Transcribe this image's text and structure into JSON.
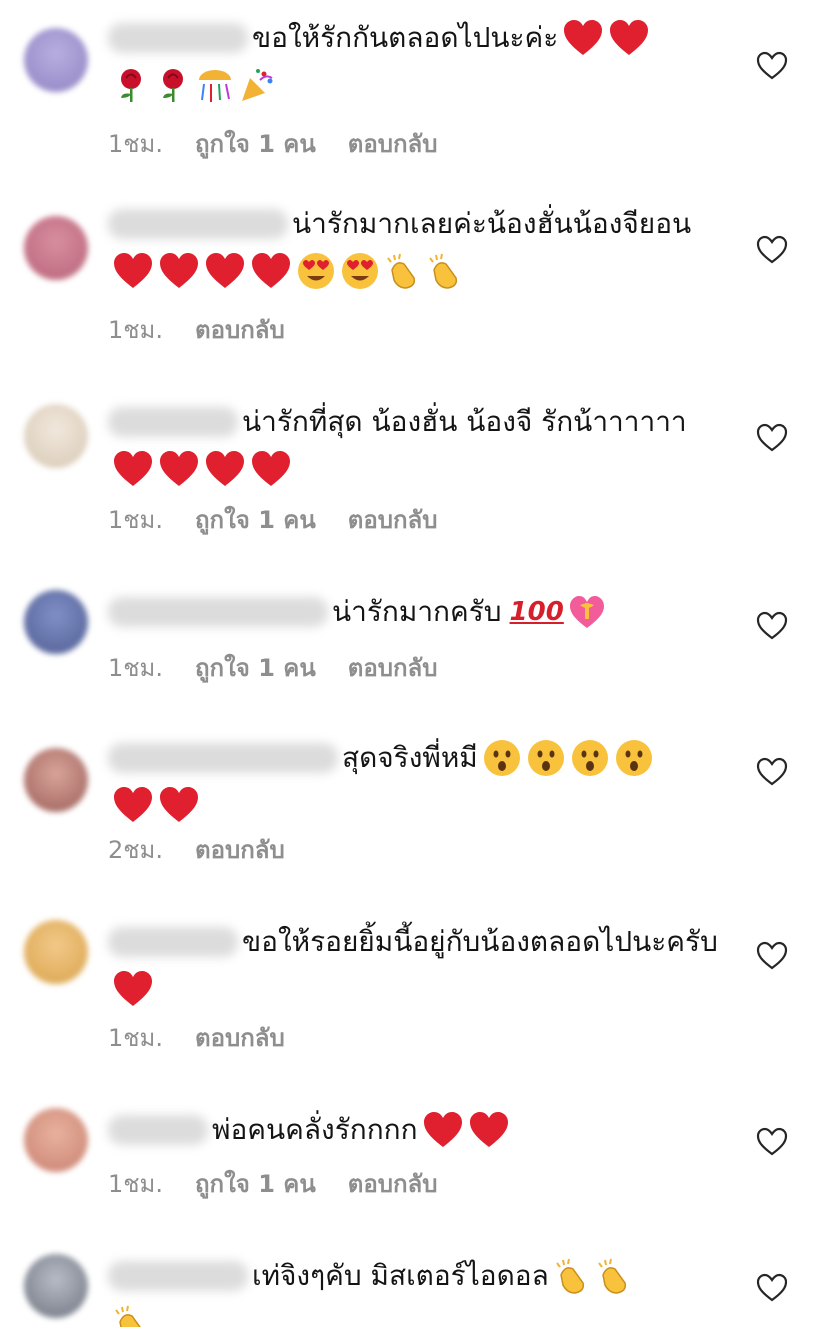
{
  "colors": {
    "text": "#141414",
    "meta": "#8e8e8e",
    "heart_red": "#e0202f",
    "icon_outline": "#262626"
  },
  "comments": [
    {
      "text": "ขอให้รักกันตลอดไปนะค่ะ",
      "emojis": [
        "red-heart",
        "red-heart",
        "rose",
        "rose",
        "confetti-ball",
        "party-popper"
      ],
      "time": "1ชม.",
      "likes": "ถูกใจ 1 คน",
      "reply": "ตอบกลับ"
    },
    {
      "text": "น่ารักมากเลยค่ะน้องฮั่นน้องจียอน",
      "emojis": [
        "red-heart",
        "red-heart",
        "red-heart",
        "red-heart",
        "heart-eyes",
        "heart-eyes",
        "clapping-hands",
        "clapping-hands"
      ],
      "time": "1ชม.",
      "reply": "ตอบกลับ"
    },
    {
      "text": "น่ารักที่สุด น้องฮั่น น้องจี รักน้าาาาาา",
      "emojis": [
        "red-heart",
        "red-heart",
        "red-heart",
        "red-heart"
      ],
      "time": "1ชม.",
      "likes": "ถูกใจ 1 คน",
      "reply": "ตอบกลับ"
    },
    {
      "text": "น่ารักมากครับ",
      "emojis": [
        "hundred-points",
        "heart-with-ribbon"
      ],
      "time": "1ชม.",
      "likes": "ถูกใจ 1 คน",
      "reply": "ตอบกลับ"
    },
    {
      "text": "สุดจริงพี่หมี",
      "emojis": [
        "open-mouth-face",
        "open-mouth-face",
        "open-mouth-face",
        "open-mouth-face",
        "red-heart",
        "red-heart"
      ],
      "time": "2ชม.",
      "reply": "ตอบกลับ"
    },
    {
      "text": "ขอให้รอยยิ้มนี้อยู่กับน้องตลอดไปนะครับ",
      "emojis": [
        "red-heart"
      ],
      "time": "1ชม.",
      "reply": "ตอบกลับ"
    },
    {
      "text": "พ่อคนคลั่งรักกกก",
      "emojis": [
        "red-heart",
        "red-heart"
      ],
      "time": "1ชม.",
      "likes": "ถูกใจ 1 คน",
      "reply": "ตอบกลับ"
    },
    {
      "text": "เท่จิงๆคับ มิสเตอร์ไอดอล",
      "emojis": [
        "clapping-hands",
        "clapping-hands",
        "clapping-hands"
      ]
    }
  ],
  "hundred_text": "100"
}
